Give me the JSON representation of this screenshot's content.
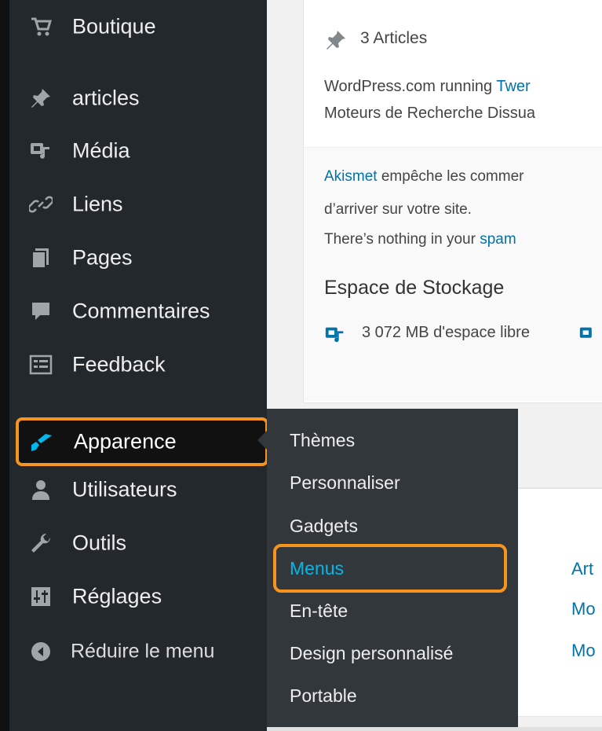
{
  "sidebar": {
    "items": [
      {
        "label": "Boutique",
        "icon": "cart-icon"
      },
      {
        "label": "articles",
        "icon": "pin-icon"
      },
      {
        "label": "Média",
        "icon": "media-icon"
      },
      {
        "label": "Liens",
        "icon": "link-icon"
      },
      {
        "label": "Pages",
        "icon": "pages-icon"
      },
      {
        "label": "Commentaires",
        "icon": "comment-icon"
      },
      {
        "label": "Feedback",
        "icon": "feedback-icon"
      },
      {
        "label": "Apparence",
        "icon": "brush-icon"
      },
      {
        "label": "Utilisateurs",
        "icon": "user-icon"
      },
      {
        "label": "Outils",
        "icon": "wrench-icon"
      },
      {
        "label": "Réglages",
        "icon": "settings-icon"
      },
      {
        "label": "Réduire le menu",
        "icon": "collapse-icon"
      }
    ]
  },
  "submenu": {
    "items": [
      "Thèmes",
      "Personnaliser",
      "Gadgets",
      "Menus",
      "En-tête",
      "Design personnalisé",
      "Portable"
    ],
    "active": "Menus"
  },
  "dashboard": {
    "articles_link": "3 Articles",
    "running_prefix": "WordPress.com running ",
    "running_theme": "Twer",
    "search_engines": "Moteurs de Recherche Dissua",
    "akismet_link": "Akismet",
    "akismet_text": " empêche les commer",
    "akismet_text2": "d’arriver sur votre site.",
    "spam_prefix": "There’s nothing in your ",
    "spam_link": "spam",
    "storage_title": "Espace de Stockage",
    "storage_free": "3 072 MB d'espace libre",
    "right_links": [
      "Art",
      "Mo",
      "Mo"
    ]
  },
  "colors": {
    "sidebar_bg": "#23282d",
    "submenu_bg": "#32373c",
    "highlight": "#f7941d",
    "link": "#0073aa",
    "active_icon": "#00b9eb"
  }
}
